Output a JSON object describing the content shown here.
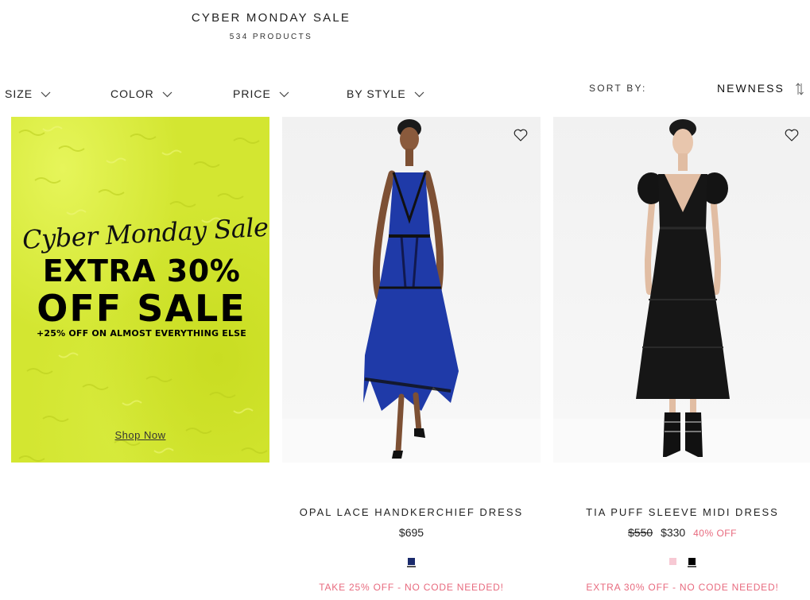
{
  "header": {
    "title": "CYBER MONDAY SALE",
    "count": "534 PRODUCTS"
  },
  "filters": {
    "size": "SIZE",
    "color": "COLOR",
    "price": "PRICE",
    "style": "BY STYLE"
  },
  "sort": {
    "label": "SORT BY:",
    "value": "NEWNESS"
  },
  "promo": {
    "script": "Cyber Monday Sale",
    "line1": "EXTRA 30%",
    "line2": "OFF SALE",
    "sub": "+25% OFF ON ALMOST EVERYTHING ELSE",
    "cta": "Shop Now",
    "bg_color": "#d3e631"
  },
  "products": [
    {
      "name": "OPAL LACE HANDKERCHIEF DRESS",
      "price": "$695",
      "swatches": [
        "#1a2a6c"
      ],
      "message": "TAKE 25% OFF - NO CODE NEEDED!"
    },
    {
      "name": "TIA PUFF SLEEVE MIDI DRESS",
      "original_price": "$550",
      "sale_price": "$330",
      "discount": "40% OFF",
      "swatches": [
        "#f7c9d4",
        "#000000"
      ],
      "message": "EXTRA 30% OFF - NO CODE NEEDED!"
    }
  ],
  "accent_color": "#e86a7e"
}
